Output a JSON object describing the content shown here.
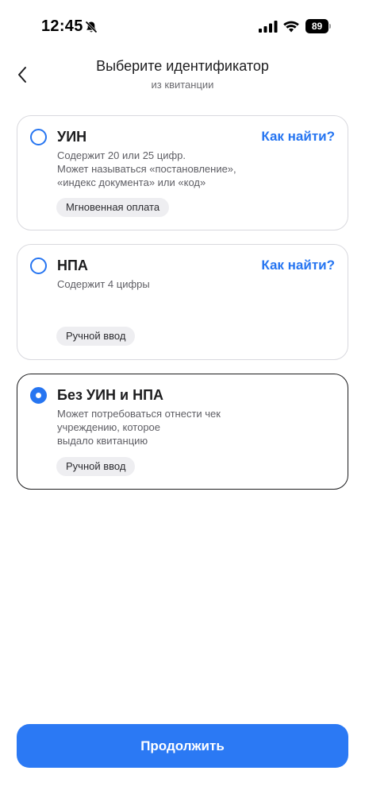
{
  "status_bar": {
    "time": "12:45",
    "battery": "89",
    "icons": [
      "bell-off-icon",
      "signal-icon",
      "wifi-icon",
      "battery-icon"
    ]
  },
  "header": {
    "title": "Выберите идентификатор",
    "subtitle": "из квитанции",
    "back_icon": "chevron-left-icon"
  },
  "options": [
    {
      "title": "УИН",
      "link": "Как найти?",
      "description": "Содержит 20 или 25 цифр.\nМожет называться «постановление»,\n«индекс документа» или «код»",
      "tag": "Мгновенная оплата",
      "selected": false
    },
    {
      "title": "НПА",
      "link": "Как найти?",
      "description": "Содержит 4 цифры",
      "tag": "Ручной ввод",
      "selected": false
    },
    {
      "title": "Без УИН и НПА",
      "description": "Может потребоваться отнести чек\nучреждению, которое\nвыдало квитанцию",
      "tag": "Ручной ввод",
      "selected": true
    }
  ],
  "footer": {
    "continue_label": "Продолжить"
  },
  "colors": {
    "accent": "#2675f1",
    "button": "#2b79f4",
    "text": "#1c1c1e",
    "secondary_text": "#5e5e64",
    "tag_bg": "#eeeef1"
  }
}
